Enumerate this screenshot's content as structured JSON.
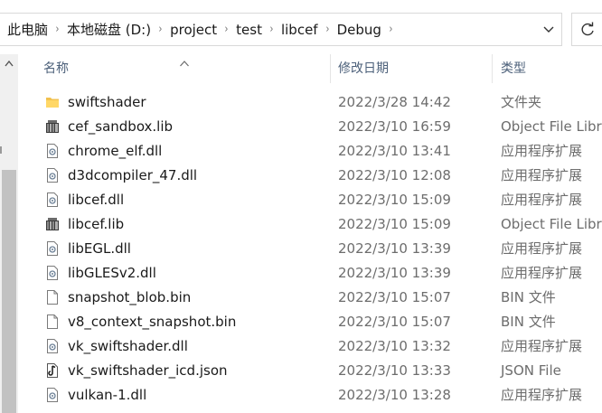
{
  "breadcrumb": {
    "items": [
      "此电脑",
      "本地磁盘 (D:)",
      "project",
      "test",
      "libcef",
      "Debug"
    ],
    "separator": "›"
  },
  "columns": {
    "name": "名称",
    "date": "修改日期",
    "type": "类型"
  },
  "files": [
    {
      "name": "swiftshader",
      "date": "2022/3/28 14:42",
      "type": "文件夹",
      "icon": "folder-icon"
    },
    {
      "name": "cef_sandbox.lib",
      "date": "2022/3/10 16:59",
      "type": "Object File Library",
      "icon": "library-file-icon"
    },
    {
      "name": "chrome_elf.dll",
      "date": "2022/3/10 13:41",
      "type": "应用程序扩展",
      "icon": "dll-file-icon"
    },
    {
      "name": "d3dcompiler_47.dll",
      "date": "2022/3/10 12:08",
      "type": "应用程序扩展",
      "icon": "dll-file-icon"
    },
    {
      "name": "libcef.dll",
      "date": "2022/3/10 15:09",
      "type": "应用程序扩展",
      "icon": "dll-file-icon"
    },
    {
      "name": "libcef.lib",
      "date": "2022/3/10 15:09",
      "type": "Object File Library",
      "icon": "library-file-icon"
    },
    {
      "name": "libEGL.dll",
      "date": "2022/3/10 13:39",
      "type": "应用程序扩展",
      "icon": "dll-file-icon"
    },
    {
      "name": "libGLESv2.dll",
      "date": "2022/3/10 13:39",
      "type": "应用程序扩展",
      "icon": "dll-file-icon"
    },
    {
      "name": "snapshot_blob.bin",
      "date": "2022/3/10 15:07",
      "type": "BIN 文件",
      "icon": "blank-file-icon"
    },
    {
      "name": "v8_context_snapshot.bin",
      "date": "2022/3/10 15:07",
      "type": "BIN 文件",
      "icon": "blank-file-icon"
    },
    {
      "name": "vk_swiftshader.dll",
      "date": "2022/3/10 13:32",
      "type": "应用程序扩展",
      "icon": "dll-file-icon"
    },
    {
      "name": "vk_swiftshader_icd.json",
      "date": "2022/3/10 13:33",
      "type": "JSON File",
      "icon": "json-file-icon"
    },
    {
      "name": "vulkan-1.dll",
      "date": "2022/3/10 13:28",
      "type": "应用程序扩展",
      "icon": "dll-file-icon"
    }
  ],
  "colors": {
    "header_text": "#4c607a",
    "secondary_text": "#6d6d6d",
    "folder": "#f2c14e",
    "scroll_thumb": "#c2c2c2"
  }
}
